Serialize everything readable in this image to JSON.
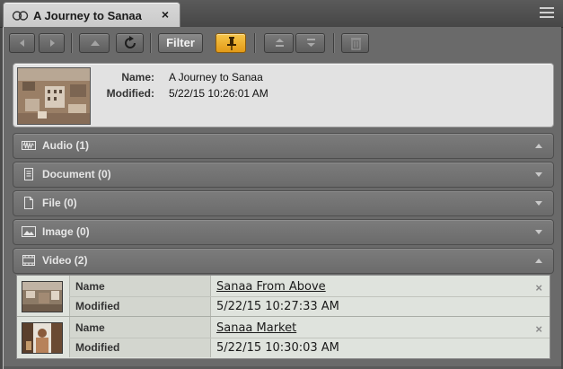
{
  "tab": {
    "title": "A Journey to Sanaa",
    "close_glyph": "×",
    "icon": "linked-clip-icon"
  },
  "panel_menu_icon": "hamburger-menu-icon",
  "toolbar": {
    "back_icon": "arrow-left-icon",
    "forward_icon": "arrow-right-icon",
    "up_icon": "arrow-up-icon",
    "refresh_icon": "refresh-icon",
    "filter_label": "Filter",
    "pin_icon": "pin-icon",
    "expand_all_icon": "expand-all-icon",
    "collapse_all_icon": "collapse-all-icon",
    "delete_icon": "trash-icon",
    "pin_color": "#f0b232"
  },
  "asset": {
    "name_label": "Name:",
    "name_value": "A Journey to Sanaa",
    "modified_label": "Modified:",
    "modified_value": "5/22/15 10:26:01 AM"
  },
  "sections": [
    {
      "label": "Audio (1)",
      "icon": "audio-waveform-icon",
      "state": "collapsed"
    },
    {
      "label": "Document (0)",
      "icon": "document-icon",
      "state": "collapsed"
    },
    {
      "label": "File (0)",
      "icon": "file-icon",
      "state": "collapsed"
    },
    {
      "label": "Image (0)",
      "icon": "image-icon",
      "state": "collapsed"
    },
    {
      "label": "Video (2)",
      "icon": "film-strip-icon",
      "state": "expanded"
    }
  ],
  "videos": [
    {
      "name_label": "Name",
      "name": "Sanaa From Above",
      "modified_label": "Modified",
      "modified": "5/22/15 10:27:33 AM",
      "remove_glyph": "×"
    },
    {
      "name_label": "Name",
      "name": "Sanaa Market",
      "modified_label": "Modified",
      "modified": "5/22/15 10:30:03 AM",
      "remove_glyph": "×"
    }
  ]
}
